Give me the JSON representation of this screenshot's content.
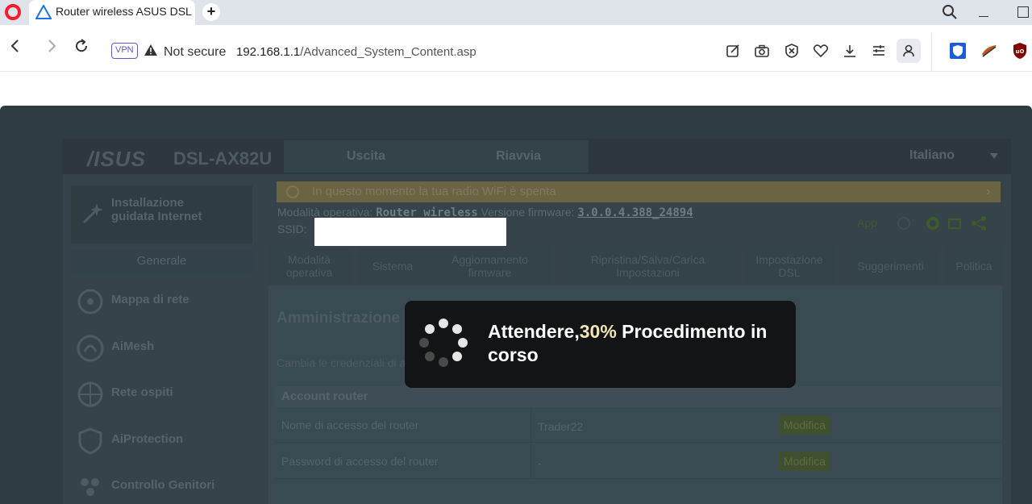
{
  "browser": {
    "tab_title": "Router wireless ASUS DSL",
    "new_tab_label": "+",
    "vpn_badge": "VPN",
    "security_text": "Not secure",
    "url_host": "192.168.1.1",
    "url_path": "/Advanced_System_Content.asp"
  },
  "header": {
    "logo": "/ISUS",
    "model": "DSL-AX82U",
    "logout_label": "Uscita",
    "reboot_label": "Riavvia",
    "language": "Italiano"
  },
  "sidebar": {
    "wizard_label_line1": "Installazione",
    "wizard_label_line2": "guidata Internet",
    "section_title": "Generale",
    "items": [
      {
        "label": "Mappa di rete",
        "icon": "network-map-icon"
      },
      {
        "label": "AiMesh",
        "icon": "aimesh-icon"
      },
      {
        "label": "Rete ospiti",
        "icon": "guest-network-icon"
      },
      {
        "label": "AiProtection",
        "icon": "shield-icon"
      },
      {
        "label": "Controllo Genitori",
        "icon": "parental-control-icon"
      }
    ]
  },
  "notice": {
    "text": "In questo momento la tua radio WiFi è spenta"
  },
  "status": {
    "op_mode_label": "Modalità operativa:",
    "op_mode_value": "Router wireless",
    "fw_label": "Versione firmware:",
    "fw_value": "3.0.0.4.388_24894",
    "ssid_label": "SSID:",
    "app_label": "App"
  },
  "subtabs": [
    {
      "line1": "Modalità",
      "line2": "operativa"
    },
    {
      "line1": "Sistema",
      "line2": ""
    },
    {
      "line1": "Aggiornamento",
      "line2": "firmware"
    },
    {
      "line1": "Ripristina/Salva/Carica",
      "line2": "Impostazioni"
    },
    {
      "line1": "Impostazione",
      "line2": "DSL"
    },
    {
      "line1": "Suggerimenti",
      "line2": ""
    },
    {
      "line1": "Politica",
      "line2": ""
    }
  ],
  "content": {
    "title": "Amministrazione - Sistema",
    "description": "Cambia le credenziali di accesso al router, il fuso orario e le impostazioni del server NTP.",
    "account_section": "Account router",
    "rows": [
      {
        "label": "Nome di accesso del router",
        "value": "Trader22",
        "button": "Modifica"
      },
      {
        "label": "Password di accesso del router",
        "value": "-",
        "button": "Modifica"
      }
    ]
  },
  "loading": {
    "prefix": "Attendere,",
    "percent": "30%",
    "suffix": " Procedimento in corso",
    "progress": 0.3
  },
  "colors": {
    "accent_vpn": "#5b57d1",
    "opera_red": "#ff1b2d",
    "overlay_dark": "#2f3c42",
    "loading_highlight": "#f0e7b4"
  }
}
